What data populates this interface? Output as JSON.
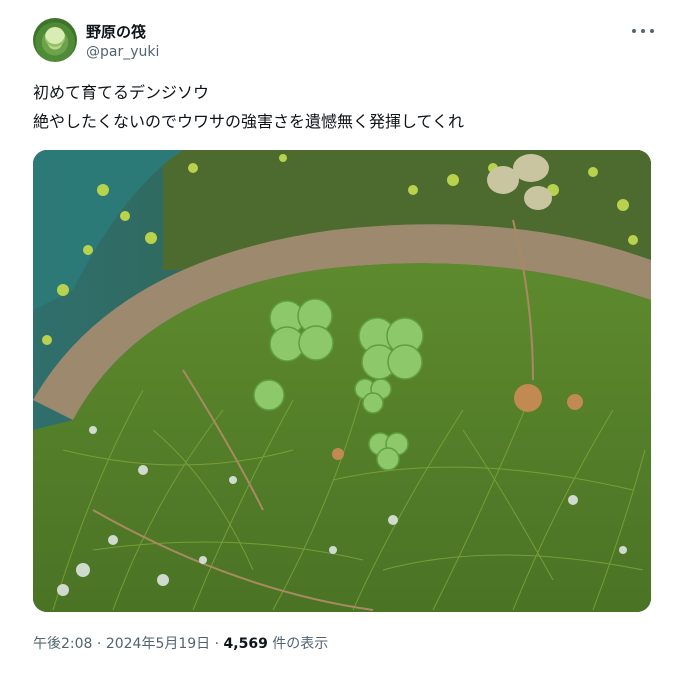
{
  "author": {
    "name": "野原の筏",
    "handle": "@par_yuki",
    "avatar_icon": "aquatic-plant-avatar"
  },
  "tweet": {
    "line1": "初めて育てるデンジソウ",
    "line2": "絶やしたくないのでウワサの強害さを遺憾無く発揮してくれ"
  },
  "photo": {
    "alt_subject": "water-clover-in-pot-photo"
  },
  "meta": {
    "time": "午後2:08",
    "sep1": " · ",
    "date": "2024年5月19日",
    "sep2": " · ",
    "views": "4,569",
    "views_suffix": " 件の表示"
  },
  "icons": {
    "more": "more-horizontal-icon"
  }
}
